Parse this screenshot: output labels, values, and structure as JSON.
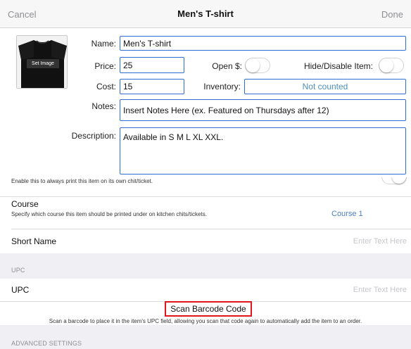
{
  "nav": {
    "cancel": "Cancel",
    "title": "Men's T-shirt",
    "done": "Done"
  },
  "image": {
    "overlay": "Set Image",
    "shirt_color": "#111111"
  },
  "form": {
    "name_label": "Name:",
    "name_value": "Men's T-shirt",
    "price_label": "Price:",
    "price_value": "25",
    "open_label": "Open $:",
    "open_on": false,
    "hide_label": "Hide/Disable Item:",
    "hide_on": false,
    "cost_label": "Cost:",
    "cost_value": "15",
    "inventory_label": "Inventory:",
    "inventory_value": "Not counted",
    "notes_label": "Notes:",
    "notes_value": "Insert Notes Here (ex. Featured on Thursdays after 12)",
    "description_label": "Description:",
    "description_value": "Available in S M L XL XXL."
  },
  "own_chit": {
    "description": "Enable this to always print this item on its own chit/ticket."
  },
  "course": {
    "title": "Course",
    "description": "Specify which course this item should be printed under on kitchen chits/tickets.",
    "value": "Course 1"
  },
  "short_name": {
    "title": "Short Name",
    "placeholder": "Enter Text Here"
  },
  "upc_section": {
    "header": "UPC",
    "title": "UPC",
    "placeholder": "Enter Text Here",
    "scan_button": "Scan Barcode Code",
    "scan_description": "Scan a barcode to place it in the item's UPC field, allowing you scan that code again to automatically add the item to an order."
  },
  "advanced": {
    "header": "ADVANCED SETTINGS"
  },
  "colors": {
    "field_border": "#2f6fd3",
    "link": "#4a7fc0",
    "highlight": "#e0161b"
  }
}
